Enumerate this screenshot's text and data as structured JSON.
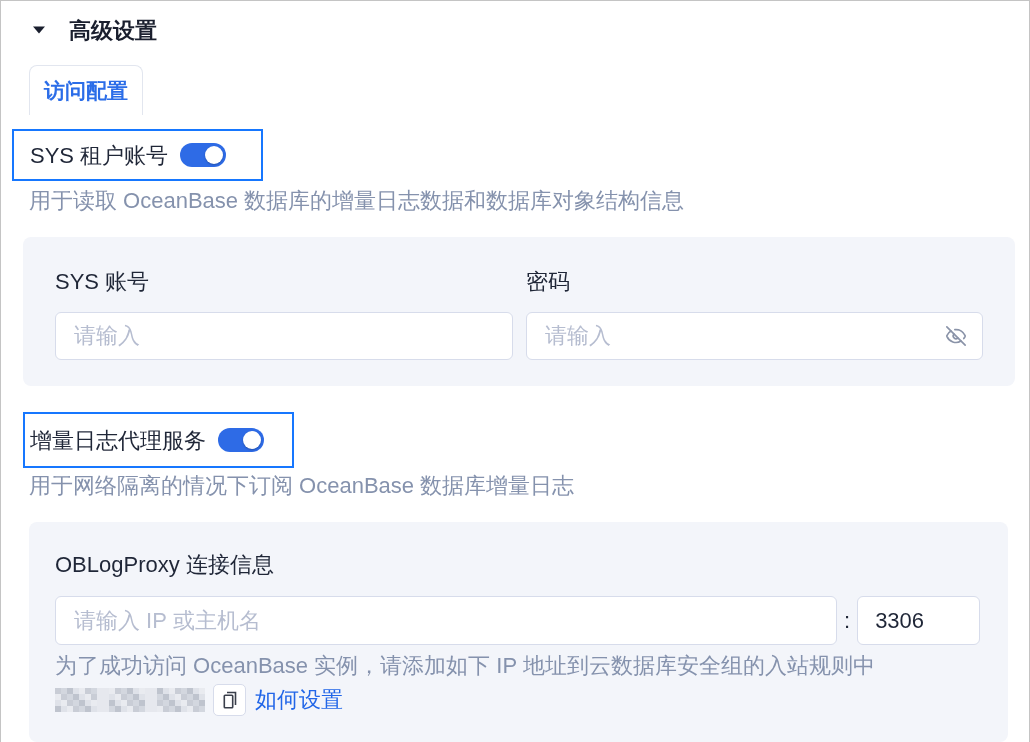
{
  "section": {
    "title": "高级设置",
    "expanded": true
  },
  "tabs": [
    {
      "label": "访问配置",
      "selected": true
    }
  ],
  "settings": [
    {
      "kind": "credentials",
      "label": "SYS 租户账号",
      "on": true,
      "highlighted": true,
      "description": "用于读取 OceanBase 数据库的增量日志数据和数据库对象结构信息",
      "fields": [
        {
          "kind": "text",
          "label": "SYS 账号",
          "placeholder": "请输入"
        },
        {
          "kind": "password",
          "label": "密码",
          "placeholder": "请输入"
        }
      ]
    },
    {
      "kind": "proxy",
      "label": "增量日志代理服务",
      "on": true,
      "highlighted": true,
      "description": "用于网络隔离的情况下订阅 OceanBase 数据库增量日志",
      "connection": {
        "label": "OBLogProxy 连接信息",
        "host": {
          "placeholder": "请输入 IP 或主机名"
        },
        "separator": ":",
        "port": {
          "value": "3306"
        },
        "note": "为了成功访问 OceanBase 实例，请添加如下 IP 地址到云数据库安全组的入站规则中",
        "link": "如何设置"
      }
    }
  ]
}
